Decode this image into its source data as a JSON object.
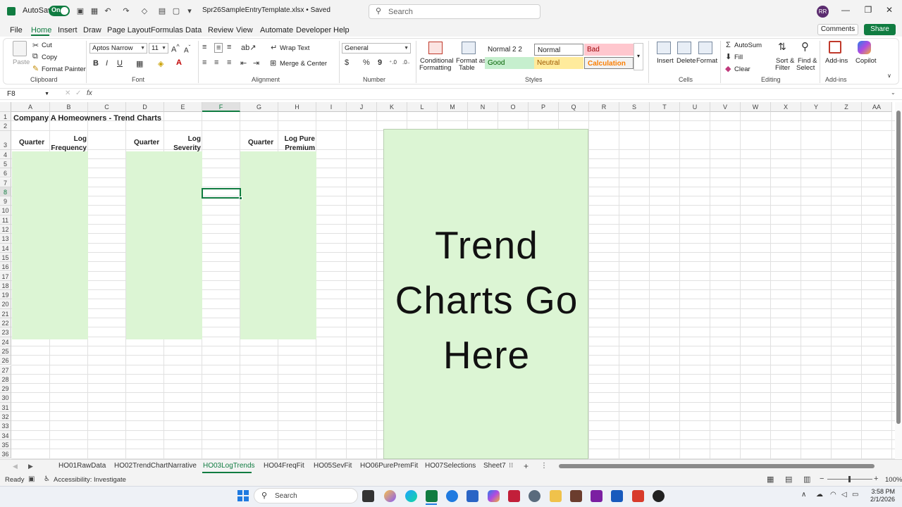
{
  "titlebar": {
    "autosave_label": "AutoSave",
    "autosave_state": "On",
    "filename": "Spr26SampleEntryTemplate.xlsx • Saved",
    "search_placeholder": "Search",
    "avatar_initials": "RR"
  },
  "menu": {
    "items": [
      "File",
      "Home",
      "Insert",
      "Draw",
      "Page Layout",
      "Formulas",
      "Data",
      "Review",
      "View",
      "Automate",
      "Developer",
      "Help"
    ],
    "active": "Home",
    "comments_label": "Comments",
    "share_label": "Share"
  },
  "ribbon": {
    "clipboard": {
      "paste": "Paste",
      "cut": "Cut",
      "copy": "Copy",
      "format_painter": "Format Painter",
      "label": "Clipboard"
    },
    "font": {
      "name": "Aptos Narrow",
      "size": "11",
      "label": "Font",
      "bold": "B",
      "italic": "I",
      "underline": "U"
    },
    "alignment": {
      "wrap_text": "Wrap Text",
      "merge_center": "Merge & Center",
      "label": "Alignment"
    },
    "number": {
      "format": "General",
      "label": "Number",
      "currency": "$",
      "percent": "%",
      "comma": "9"
    },
    "styles": {
      "conditional": [
        "Conditional",
        "Formatting"
      ],
      "format_as_table": [
        "Format as",
        "Table"
      ],
      "cells": [
        {
          "name": "Normal 2 2",
          "bg": "#ffffff",
          "fg": "#222222"
        },
        {
          "name": "Normal",
          "bg": "#ffffff",
          "fg": "#222222"
        },
        {
          "name": "Bad",
          "bg": "#ffc7ce",
          "fg": "#9c0006"
        },
        {
          "name": "Good",
          "bg": "#c6efce",
          "fg": "#006100"
        },
        {
          "name": "Neutral",
          "bg": "#ffeb9c",
          "fg": "#9c5700"
        },
        {
          "name": "Calculation",
          "bg": "#f2f2f2",
          "fg": "#fa7d00"
        }
      ],
      "label": "Styles"
    },
    "cells": {
      "insert": "Insert",
      "delete": "Delete",
      "format": "Format",
      "label": "Cells"
    },
    "editing": {
      "autosum": "AutoSum",
      "fill": "Fill",
      "clear": "Clear",
      "sort_filter": [
        "Sort &",
        "Filter"
      ],
      "find_select": [
        "Find &",
        "Select"
      ],
      "label": "Editing"
    },
    "addins": {
      "addins": "Add-ins",
      "copilot": "Copilot",
      "label": "Add-ins"
    }
  },
  "formula_bar": {
    "name_box": "F8",
    "fx": "fx",
    "content": ""
  },
  "sheet": {
    "columns": [
      "A",
      "B",
      "C",
      "D",
      "E",
      "F",
      "G",
      "H",
      "I",
      "J",
      "K",
      "L",
      "M",
      "N",
      "O",
      "P",
      "Q",
      "R",
      "S",
      "T",
      "U",
      "V",
      "W",
      "X",
      "Y",
      "Z",
      "AA"
    ],
    "rows": [
      "1",
      "2",
      "3",
      "4",
      "5",
      "6",
      "7",
      "8",
      "9",
      "10",
      "11",
      "12",
      "13",
      "14",
      "15",
      "16",
      "17",
      "18",
      "19",
      "20",
      "21",
      "22",
      "23",
      "24",
      "25",
      "26",
      "27",
      "28",
      "29",
      "30",
      "31",
      "32",
      "33",
      "34",
      "35",
      "36"
    ],
    "selected_cell": "F8",
    "title": "Company A Homeowners - Trend Charts",
    "headers": {
      "a3": "Quarter",
      "b3": [
        "Log",
        "Frequency"
      ],
      "d3": "Quarter",
      "e3": [
        "Log",
        "Severity"
      ],
      "g3": "Quarter",
      "h3": [
        "Log Pure",
        "Premium"
      ]
    },
    "textbox": [
      "Trend",
      "Charts Go",
      "Here"
    ],
    "fill_color": "#dcf5d4"
  },
  "tabs": {
    "items": [
      "HO01RawData",
      "HO02TrendChartNarrative",
      "HO03LogTrends",
      "HO04FreqFit",
      "HO05SevFit",
      "HO06PurePremFit",
      "HO07Selections",
      "Sheet7"
    ],
    "active": "HO03LogTrends"
  },
  "status": {
    "ready": "Ready",
    "accessibility": "Accessibility: Investigate",
    "zoom": "100%"
  },
  "taskbar": {
    "search_placeholder": "Search",
    "time": "3:58 PM",
    "date": "2/1/2026"
  },
  "accent": "#107c41"
}
